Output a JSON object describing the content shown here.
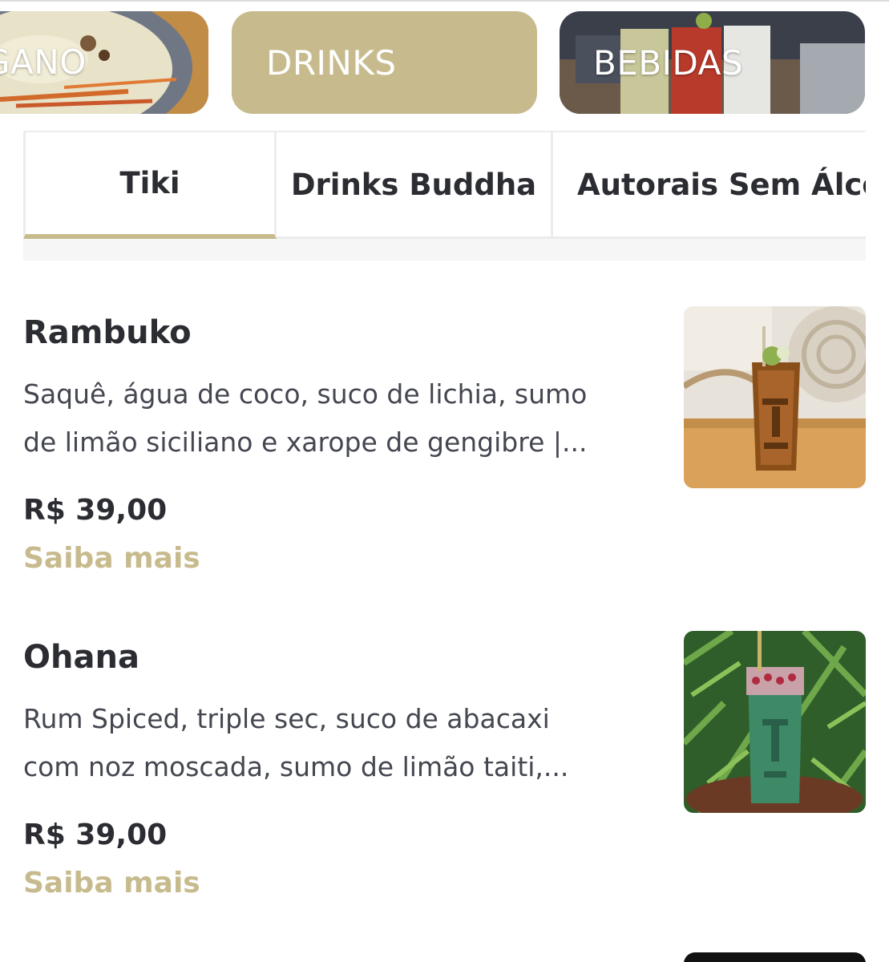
{
  "categories": [
    {
      "label": "GANO",
      "style": "image"
    },
    {
      "label": "DRINKS",
      "style": "selected"
    },
    {
      "label": "BEBIDAS",
      "style": "image"
    }
  ],
  "tabs": [
    {
      "label": "Tiki",
      "active": true
    },
    {
      "label": "Drinks Buddha",
      "active": false
    },
    {
      "label": "Autorais Sem Álcoo",
      "active": false
    }
  ],
  "products": [
    {
      "name": "Rambuko",
      "description_lines": [
        "Saquê, água de coco, suco de lichia, sumo",
        "de limão siciliano e xarope de gengibre |..."
      ],
      "price": "R$ 39,00",
      "more": "Saiba mais",
      "image_icon": "tiki-mug-brown-photo"
    },
    {
      "name": "Ohana",
      "description_lines": [
        "Rum Spiced, triple sec, suco de abacaxi",
        "com noz moscada, sumo de limão taiti,..."
      ],
      "price": "R$ 39,00",
      "more": "Saiba mais",
      "image_icon": "tiki-mug-green-photo"
    }
  ],
  "colors": {
    "accent": "#c7bb8e",
    "text": "#2b2d33",
    "border": "#ececec"
  }
}
